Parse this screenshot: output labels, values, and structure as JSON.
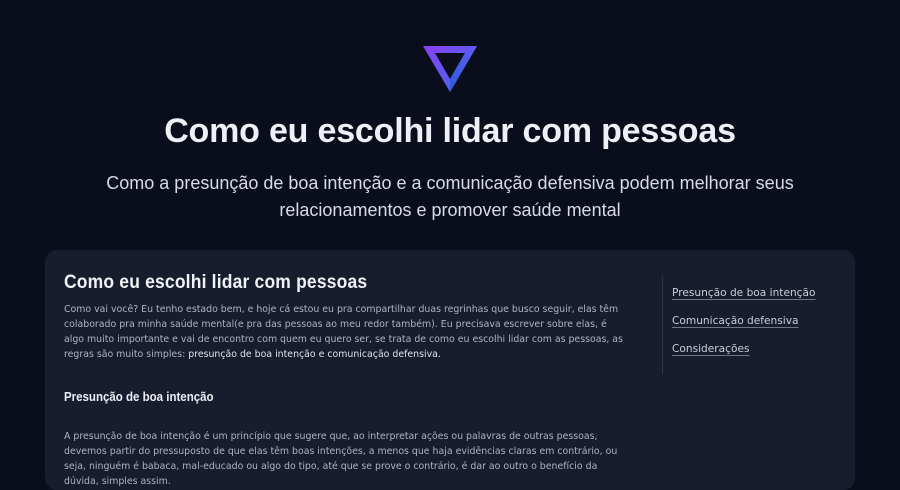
{
  "hero": {
    "logo_icon": "triangle-logo-icon",
    "title": "Como eu escolhi lidar com pessoas",
    "subtitle": "Como a presunção de boa intenção e a comunicação defensiva podem melhorar seus relacionamentos e promover saúde mental"
  },
  "article": {
    "title": "Como eu escolhi lidar com pessoas",
    "intro": "Como vai você? Eu tenho estado bem, e hoje cá estou eu pra compartilhar duas regrinhas que busco seguir, elas têm colaborado pra minha saúde mental(e pra das pessoas ao meu redor também). Eu precisava escrever sobre elas, é algo muito importante e vai de encontro com quem eu quero ser, se trata de como eu escolhi lidar com as pessoas, as regras são muito simples: ",
    "intro_highlight": "presunção de boa intenção e comunicação defensiva.",
    "section1_title": "Presunção de boa intenção",
    "section1_text": "A presunção de boa intenção é um princípio que sugere que, ao interpretar ações ou palavras de outras pessoas, devemos partir do pressuposto de que elas têm boas intenções, a menos que haja evidências claras em contrário, ou seja, ninguém é babaca, mal-educado ou algo do tipo, até que se prove o contrário, é dar ao outro o benefício da dúvida, simples assim."
  },
  "toc": {
    "items": [
      "Presunção de boa intenção",
      "Comunicação defensiva",
      "Considerações"
    ]
  },
  "colors": {
    "background": "#0a0e1c",
    "card": "#171d2d",
    "logo_gradient_start": "#7b3fe4",
    "logo_gradient_end": "#3b6fe8"
  }
}
